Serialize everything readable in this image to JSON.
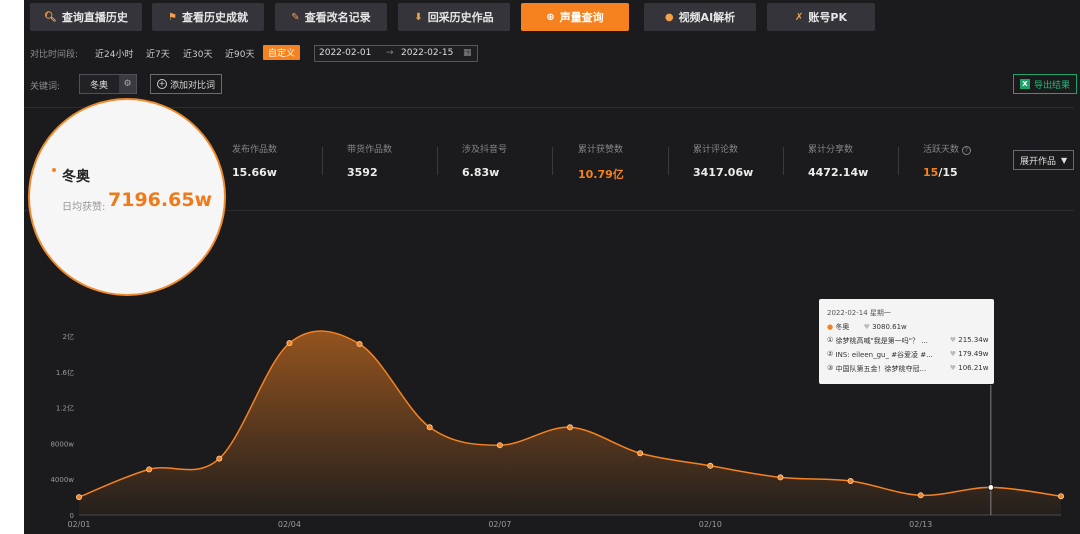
{
  "tabs": [
    {
      "label": "查询直播历史",
      "icon": "search-icon",
      "active": false
    },
    {
      "label": "查看历史成就",
      "icon": "trophy-icon",
      "active": false
    },
    {
      "label": "查看改名记录",
      "icon": "pencil-icon",
      "active": false
    },
    {
      "label": "回采历史作品",
      "icon": "download-icon",
      "active": false
    },
    {
      "label": "声量查询",
      "icon": "plus-circle-icon",
      "active": true
    },
    {
      "label": "视频AI解析",
      "icon": "brain-icon",
      "active": false
    },
    {
      "label": "账号PK",
      "icon": "vs-icon",
      "active": false
    }
  ],
  "filters": {
    "time_label": "对比时间段:",
    "ranges": [
      "近24小时",
      "近7天",
      "近30天",
      "近90天",
      "自定义"
    ],
    "active_range": "自定义",
    "date_start": "2022-02-01",
    "date_arrow": "→",
    "date_end": "2022-02-15",
    "keyword_label": "关键词:",
    "keyword": "冬奥",
    "add_compare": "添加对比词",
    "export": "导出结果"
  },
  "summary": {
    "keyword": "冬奥",
    "daily_likes_label": "日均获赞:",
    "daily_likes": "7196.65w",
    "stats": [
      {
        "label": "发布作品数",
        "value": "15.66w",
        "accent": false
      },
      {
        "label": "带货作品数",
        "value": "3592",
        "accent": false
      },
      {
        "label": "涉及抖音号",
        "value": "6.83w",
        "accent": false
      },
      {
        "label": "累计获赞数",
        "value": "10.79亿",
        "accent": true
      },
      {
        "label": "累计评论数",
        "value": "3417.06w",
        "accent": false
      },
      {
        "label": "累计分享数",
        "value": "4472.14w",
        "accent": false
      }
    ],
    "active_days_label": "活跃天数",
    "active_days": "15",
    "active_days_total": "/15",
    "expand_label": "展开作品"
  },
  "colors": {
    "accent": "#f5821f",
    "background": "#1b1b1d",
    "export_green": "#24b876"
  },
  "chart_data": {
    "type": "area",
    "x": [
      "02/01",
      "02/02",
      "02/03",
      "02/04",
      "02/05",
      "02/06",
      "02/07",
      "02/08",
      "02/09",
      "02/10",
      "02/11",
      "02/12",
      "02/13",
      "02/14",
      "02/15"
    ],
    "x_tick_labels": [
      "02/01",
      "02/04",
      "02/07",
      "02/10",
      "02/13"
    ],
    "y_tick_labels": [
      "0",
      "4000w",
      "8000w",
      "1.2亿",
      "1.6亿",
      "2亿"
    ],
    "ylim_wan": [
      0,
      20000
    ],
    "series": [
      {
        "name": "冬奥",
        "values": [
          2000,
          5100,
          6300,
          19200,
          19100,
          9800,
          7800,
          9800,
          6900,
          5500,
          4200,
          3800,
          2200,
          3080.61,
          2100
        ]
      }
    ],
    "grid": false,
    "fill": "gradient-orange"
  },
  "tooltip": {
    "date": "2022-02-14 星期一",
    "series_name": "冬奥",
    "series_value": "3080.61w",
    "rows": [
      {
        "rank": "①",
        "title": "徐梦桃高喊\"我是第一吗\"？ ...",
        "value": "215.34w"
      },
      {
        "rank": "②",
        "title": "INS: eileen_gu_ #谷爱凌 #...",
        "value": "179.49w"
      },
      {
        "rank": "③",
        "title": "中国队第五金！徐梦桃夺冠...",
        "value": "106.21w"
      }
    ]
  }
}
